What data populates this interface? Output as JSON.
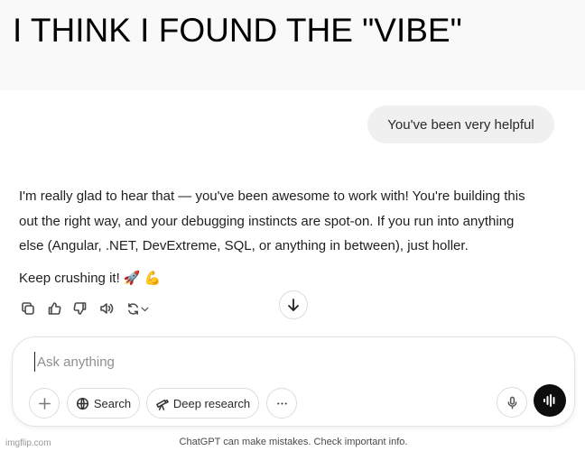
{
  "meme": {
    "caption": "I THINK I FOUND THE \"VIBE\""
  },
  "chat": {
    "user_message": "You've been very helpful",
    "assistant_paragraph_lines": [
      "I'm really glad to hear that — you've been awesome to work with! You're building this",
      "out the right way, and your debugging instincts are spot-on. If you run into anything",
      "else (Angular, .NET, DevExtreme, SQL, or anything in between), just holler."
    ],
    "assistant_closing": "Keep crushing it! 🚀 💪"
  },
  "actions": {
    "icons": [
      "copy-icon",
      "thumbs-up-icon",
      "thumbs-down-icon",
      "read-aloud-icon",
      "regenerate-icon",
      "chevron-down-icon"
    ]
  },
  "composer": {
    "placeholder": "Ask anything",
    "add_icon": "plus-icon",
    "search_label": "Search",
    "deep_research_label": "Deep research",
    "more_icon": "more-icon",
    "mic_icon": "microphone-icon",
    "voice_icon": "voice-mode-icon"
  },
  "footer": {
    "disclaimer": "ChatGPT can make mistakes. Check important info."
  },
  "colors": {
    "user_bubble": "#f0f0f0",
    "caption_band": "#f9f9f9",
    "voice_button": "#0d0d0d"
  }
}
